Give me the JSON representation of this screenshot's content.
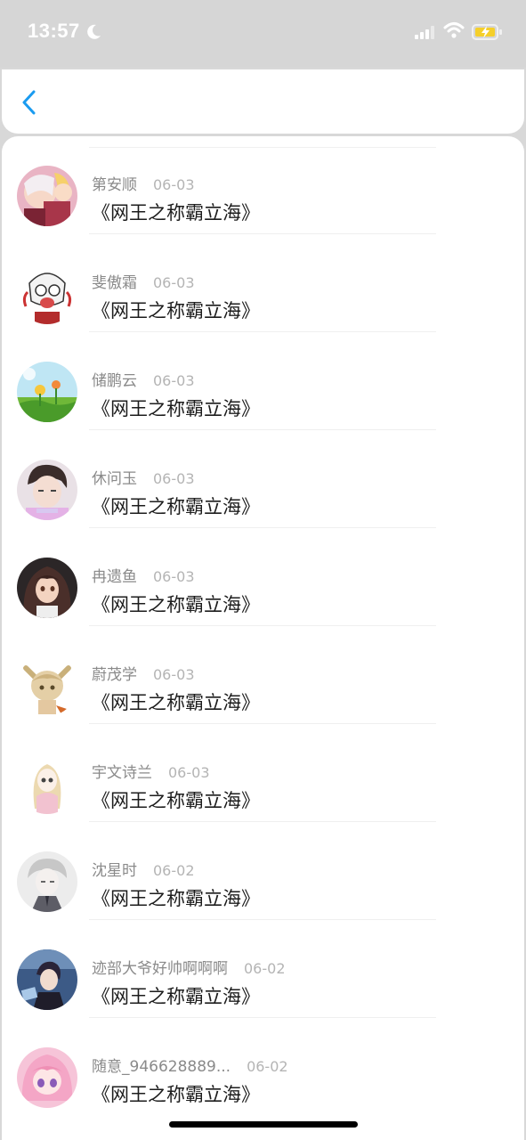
{
  "status_bar": {
    "time": "13:57",
    "icons": [
      "moon-icon",
      "signal-icon",
      "wifi-icon",
      "battery-charging-icon"
    ]
  },
  "header": {
    "back_icon": "chevron-left-icon",
    "accent_color": "#1a9bf0"
  },
  "items": [
    {
      "name": "第安顺",
      "date": "06-03",
      "title": "《网王之称霸立海》"
    },
    {
      "name": "斐傲霜",
      "date": "06-03",
      "title": "《网王之称霸立海》"
    },
    {
      "name": "储鹏云",
      "date": "06-03",
      "title": "《网王之称霸立海》"
    },
    {
      "name": "休问玉",
      "date": "06-03",
      "title": "《网王之称霸立海》"
    },
    {
      "name": "冉遗鱼",
      "date": "06-03",
      "title": "《网王之称霸立海》"
    },
    {
      "name": "蔚茂学",
      "date": "06-03",
      "title": "《网王之称霸立海》"
    },
    {
      "name": "宇文诗兰",
      "date": "06-03",
      "title": "《网王之称霸立海》"
    },
    {
      "name": "沈星时",
      "date": "06-02",
      "title": "《网王之称霸立海》"
    },
    {
      "name": "迹部大爷好帅啊啊啊",
      "date": "06-02",
      "title": "《网王之称霸立海》"
    },
    {
      "name": "随意_946628889...",
      "date": "06-02",
      "title": "《网王之称霸立海》"
    }
  ]
}
